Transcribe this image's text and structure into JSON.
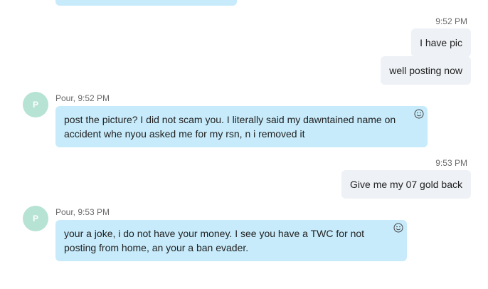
{
  "messages": [
    {
      "kind": "out",
      "time": "9:52 PM",
      "texts": [
        "I have pic",
        "well posting now"
      ]
    },
    {
      "kind": "in",
      "avatar": "P",
      "meta": "Pour, 9:52 PM",
      "text": "post the picture? I did not scam you. I literally said my dawntained name on accident whe nyou asked me for my rsn, n i removed it"
    },
    {
      "kind": "out",
      "time": "9:53 PM",
      "texts": [
        "Give me my 07 gold back"
      ]
    },
    {
      "kind": "in",
      "avatar": "P",
      "meta": "Pour, 9:53 PM",
      "text": "your a joke, i do not have your money. I see you have a TWC for not posting from home, an your a ban evader."
    }
  ],
  "colors": {
    "incoming_bubble": "#c7ebfb",
    "outgoing_bubble": "#eef1f5",
    "avatar": "#b6e3d3"
  }
}
